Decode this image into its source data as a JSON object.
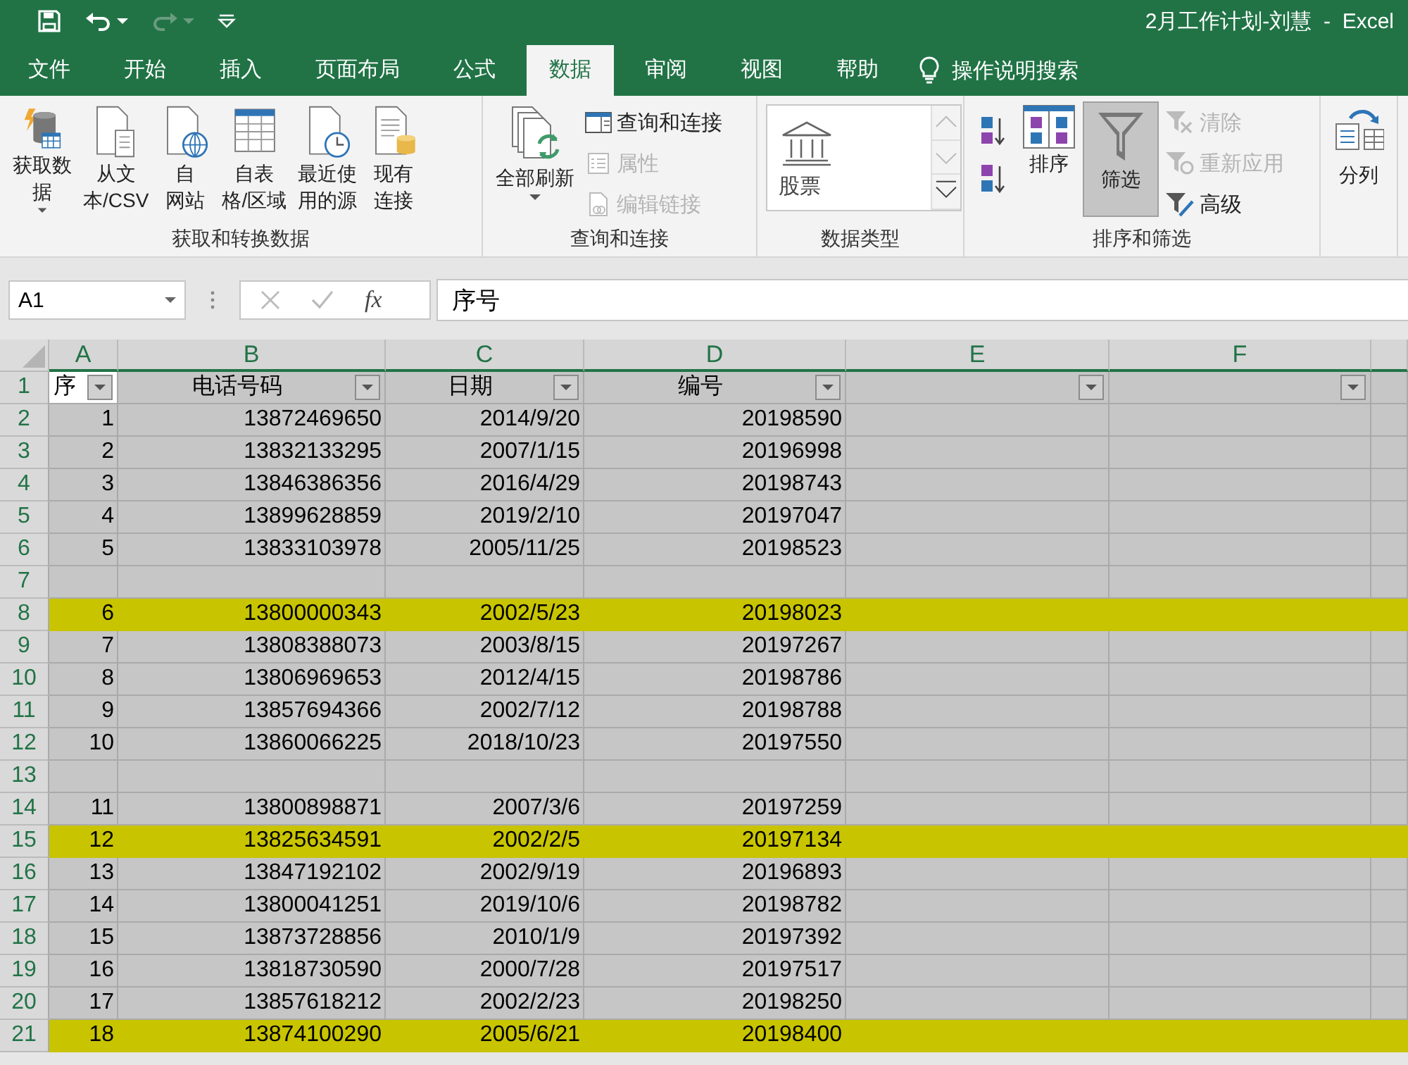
{
  "quick_access": [
    {
      "disabled": false
    },
    {
      "disabled": false
    },
    {
      "disabled": true
    },
    {
      "disabled": false
    }
  ],
  "title": "2月工作计划-刘慧  -  Excel",
  "tabs": [
    {
      "label": "文件",
      "selected": false
    },
    {
      "label": "开始",
      "selected": false
    },
    {
      "label": "插入",
      "selected": false
    },
    {
      "label": "页面布局",
      "selected": false
    },
    {
      "label": "公式",
      "selected": false
    },
    {
      "label": "数据",
      "selected": true
    },
    {
      "label": "审阅",
      "selected": false
    },
    {
      "label": "视图",
      "selected": false
    },
    {
      "label": "帮助",
      "selected": false
    }
  ],
  "tell_me": "操作说明搜索",
  "ribbon": {
    "groups": [
      {
        "label": "获取和转换数据",
        "buttons": [
          {
            "kind": "large",
            "lines": [
              "获取数",
              "据"
            ],
            "dropdown": true
          },
          {
            "kind": "large",
            "lines": [
              "从文",
              "本/CSV"
            ]
          },
          {
            "kind": "large",
            "lines": [
              "自",
              "网站"
            ]
          },
          {
            "kind": "large",
            "lines": [
              "自表",
              "格/区域"
            ]
          },
          {
            "kind": "large",
            "lines": [
              "最近使",
              "用的源"
            ]
          },
          {
            "kind": "large",
            "lines": [
              "现有",
              "连接"
            ]
          }
        ]
      },
      {
        "label": "查询和连接",
        "buttons": [
          {
            "kind": "large",
            "lines": [
              "全部刷新"
            ],
            "dropdown": true
          },
          {
            "kind": "small",
            "label": "查询和连接",
            "disabled": false
          },
          {
            "kind": "small",
            "label": "属性",
            "disabled": true
          },
          {
            "kind": "small",
            "label": "编辑链接",
            "disabled": true
          }
        ]
      },
      {
        "label": "数据类型",
        "buttons": [
          {
            "kind": "gallery",
            "label": "股票"
          }
        ]
      },
      {
        "label": "排序和筛选",
        "buttons": [
          {
            "kind": "sort-pair"
          },
          {
            "kind": "large",
            "lines": [
              "排序"
            ],
            "pressed": false
          },
          {
            "kind": "large",
            "lines": [
              "筛选"
            ],
            "pressed": true
          },
          {
            "kind": "small",
            "label": "清除",
            "disabled": true
          },
          {
            "kind": "small",
            "label": "重新应用",
            "disabled": true
          },
          {
            "kind": "small",
            "label": "高级",
            "disabled": false
          }
        ]
      },
      {
        "buttons": [
          {
            "kind": "large",
            "lines": [
              "分列"
            ]
          }
        ]
      }
    ]
  },
  "formula_bar": {
    "name_box": "A1",
    "function_label": "fx",
    "value": "序号"
  },
  "sheet": {
    "columns": [
      {
        "letter": "A",
        "header": "序"
      },
      {
        "letter": "B",
        "header": "电话号码"
      },
      {
        "letter": "C",
        "header": "日期"
      },
      {
        "letter": "D",
        "header": "编号"
      },
      {
        "letter": "E"
      },
      {
        "letter": "F"
      }
    ],
    "header_row": "1",
    "rows": [
      {
        "number": "2",
        "cells": [
          "1",
          "13872469650",
          "2014/9/20",
          "20198590"
        ],
        "highlighted": false
      },
      {
        "number": "3",
        "cells": [
          "2",
          "13832133295",
          "2007/1/15",
          "20196998"
        ],
        "highlighted": false
      },
      {
        "number": "4",
        "cells": [
          "3",
          "13846386356",
          "2016/4/29",
          "20198743"
        ],
        "highlighted": false
      },
      {
        "number": "5",
        "cells": [
          "4",
          "13899628859",
          "2019/2/10",
          "20197047"
        ],
        "highlighted": false
      },
      {
        "number": "6",
        "cells": [
          "5",
          "13833103978",
          "2005/11/25",
          "20198523"
        ],
        "highlighted": false
      },
      {
        "number": "7",
        "highlighted": false
      },
      {
        "number": "8",
        "cells": [
          "6",
          "13800000343",
          "2002/5/23",
          "20198023"
        ],
        "highlighted": true
      },
      {
        "number": "9",
        "cells": [
          "7",
          "13808388073",
          "2003/8/15",
          "20197267"
        ],
        "highlighted": false
      },
      {
        "number": "10",
        "cells": [
          "8",
          "13806969653",
          "2012/4/15",
          "20198786"
        ],
        "highlighted": false
      },
      {
        "number": "11",
        "cells": [
          "9",
          "13857694366",
          "2002/7/12",
          "20198788"
        ],
        "highlighted": false
      },
      {
        "number": "12",
        "cells": [
          "10",
          "13860066225",
          "2018/10/23",
          "20197550"
        ],
        "highlighted": false
      },
      {
        "number": "13",
        "highlighted": false
      },
      {
        "number": "14",
        "cells": [
          "11",
          "13800898871",
          "2007/3/6",
          "20197259"
        ],
        "highlighted": false
      },
      {
        "number": "15",
        "cells": [
          "12",
          "13825634591",
          "2002/2/5",
          "20197134"
        ],
        "highlighted": true
      },
      {
        "number": "16",
        "cells": [
          "13",
          "13847192102",
          "2002/9/19",
          "20196893"
        ],
        "highlighted": false
      },
      {
        "number": "17",
        "cells": [
          "14",
          "13800041251",
          "2019/10/6",
          "20198782"
        ],
        "highlighted": false
      },
      {
        "number": "18",
        "cells": [
          "15",
          "13873728856",
          "2010/1/9",
          "20197392"
        ],
        "highlighted": false
      },
      {
        "number": "19",
        "cells": [
          "16",
          "13818730590",
          "2000/7/28",
          "20197517"
        ],
        "highlighted": false
      },
      {
        "number": "20",
        "cells": [
          "17",
          "13857618212",
          "2002/2/23",
          "20198250"
        ],
        "highlighted": false
      },
      {
        "number": "21",
        "cells": [
          "18",
          "13874100290",
          "2005/6/21",
          "20198400"
        ],
        "highlighted": true
      }
    ]
  }
}
